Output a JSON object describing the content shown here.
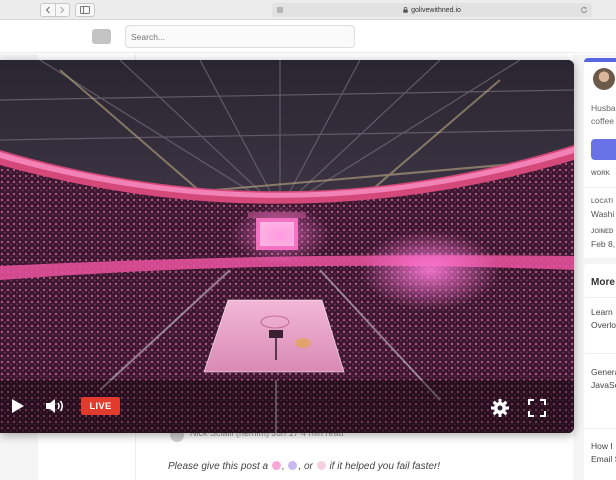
{
  "browser": {
    "url": "golivewithned.io"
  },
  "header": {
    "search_placeholder": "Search..."
  },
  "profile": {
    "bio_lines": [
      "Husba",
      "coffee"
    ],
    "work_label": "WORK",
    "location_label": "LOCATI",
    "location_value": "Washi",
    "joined_label": "JOINED",
    "joined_value": "Feb 8,"
  },
  "more_from": {
    "heading": "More",
    "items": [
      [
        "Learn",
        "Overlo"
      ],
      [
        "Genera",
        "JavaSc"
      ],
      [
        "How I",
        "Email S"
      ]
    ]
  },
  "article": {
    "author_line": "Nick Scialli (he/him)   Jun 17   4 min read",
    "cta_before": "Please give this post a",
    "cta_after": "if it helped you fail faster!",
    "cta_or": "or"
  },
  "player": {
    "live_label": "LIVE"
  },
  "colors": {
    "live": "#e23b2e",
    "accent": "#5566e0",
    "stage_pink": "#f04fd0"
  }
}
